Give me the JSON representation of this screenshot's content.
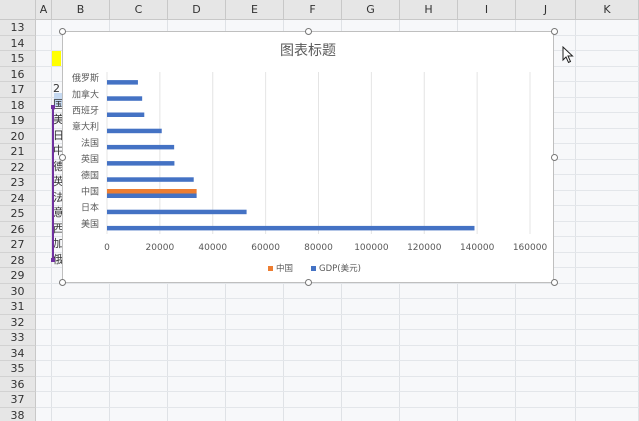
{
  "columns": [
    "A",
    "B",
    "C",
    "D",
    "E",
    "F",
    "G",
    "H",
    "I",
    "J",
    "K"
  ],
  "rows": [
    "13",
    "14",
    "15",
    "16",
    "17",
    "18",
    "19",
    "20",
    "21",
    "22",
    "23",
    "24",
    "25",
    "26",
    "27",
    "28",
    "29",
    "30",
    "31",
    "32",
    "33",
    "34",
    "35",
    "36",
    "37",
    "38",
    "39"
  ],
  "cell_peek": [
    "2",
    "国",
    "美",
    "日",
    "中",
    "德",
    "英",
    "法",
    "意",
    "西",
    "加",
    "俄"
  ],
  "colors": {
    "series_gdp": "#4472c4",
    "series_china": "#ed7d31",
    "header_bg": "#e6e6e6",
    "selection": "#7030a0",
    "highlight_cell": "#ffff00"
  },
  "chart_data": {
    "type": "bar",
    "orientation": "horizontal",
    "title": "图表标题",
    "categories": [
      "美国",
      "日本",
      "中国",
      "德国",
      "英国",
      "法国",
      "意大利",
      "西班牙",
      "加拿大",
      "俄罗斯"
    ],
    "series": [
      {
        "name": "中国",
        "color": "#ed7d31",
        "values": [
          0,
          0,
          33900,
          0,
          0,
          0,
          0,
          0,
          0,
          0
        ]
      },
      {
        "name": "GDP(美元)",
        "color": "#4472c4",
        "values": [
          139000,
          52800,
          33900,
          32800,
          25500,
          25400,
          20700,
          14100,
          13300,
          11700
        ]
      }
    ],
    "xlim": [
      0,
      160000
    ],
    "xticks": [
      "0",
      "20000",
      "40000",
      "60000",
      "80000",
      "100000",
      "120000",
      "140000",
      "160000"
    ],
    "grid": true,
    "legend": "bottom",
    "legend_labels": [
      "中国",
      "GDP(美元)"
    ]
  }
}
